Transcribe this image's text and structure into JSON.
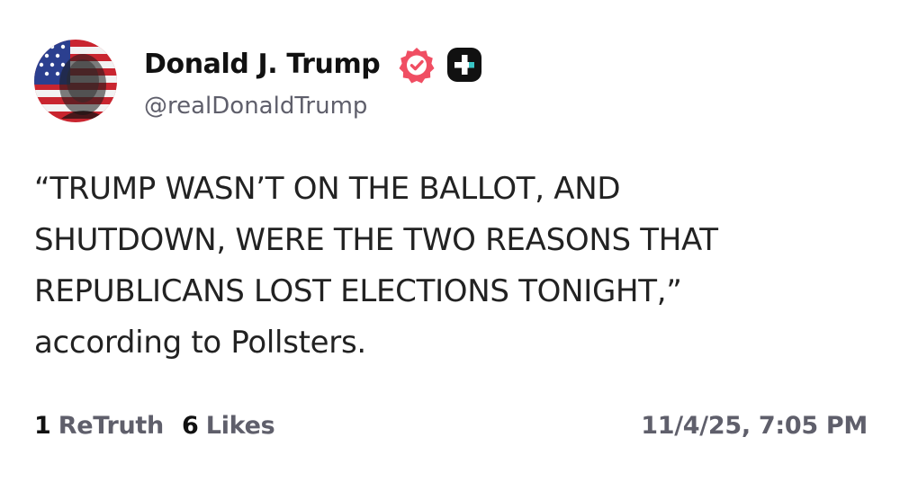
{
  "author": {
    "name": "Donald J. Trump",
    "handle": "@realDonaldTrump",
    "verified": true,
    "avatar_icon": "flag-portrait-avatar",
    "badge_icon": "truth-social-plus-icon",
    "verified_color": "#f04e63"
  },
  "post": {
    "lines": [
      "“TRUMP WASN’T ON THE BALLOT, AND",
      "SHUTDOWN, WERE THE TWO REASONS THAT",
      "REPUBLICANS LOST ELECTIONS TONIGHT,”",
      "according to Pollsters."
    ]
  },
  "stats": {
    "retruths_count": "1",
    "retruths_label": "ReTruth",
    "likes_count": "6",
    "likes_label": "Likes"
  },
  "timestamp": "11/4/25, 7:05 PM"
}
